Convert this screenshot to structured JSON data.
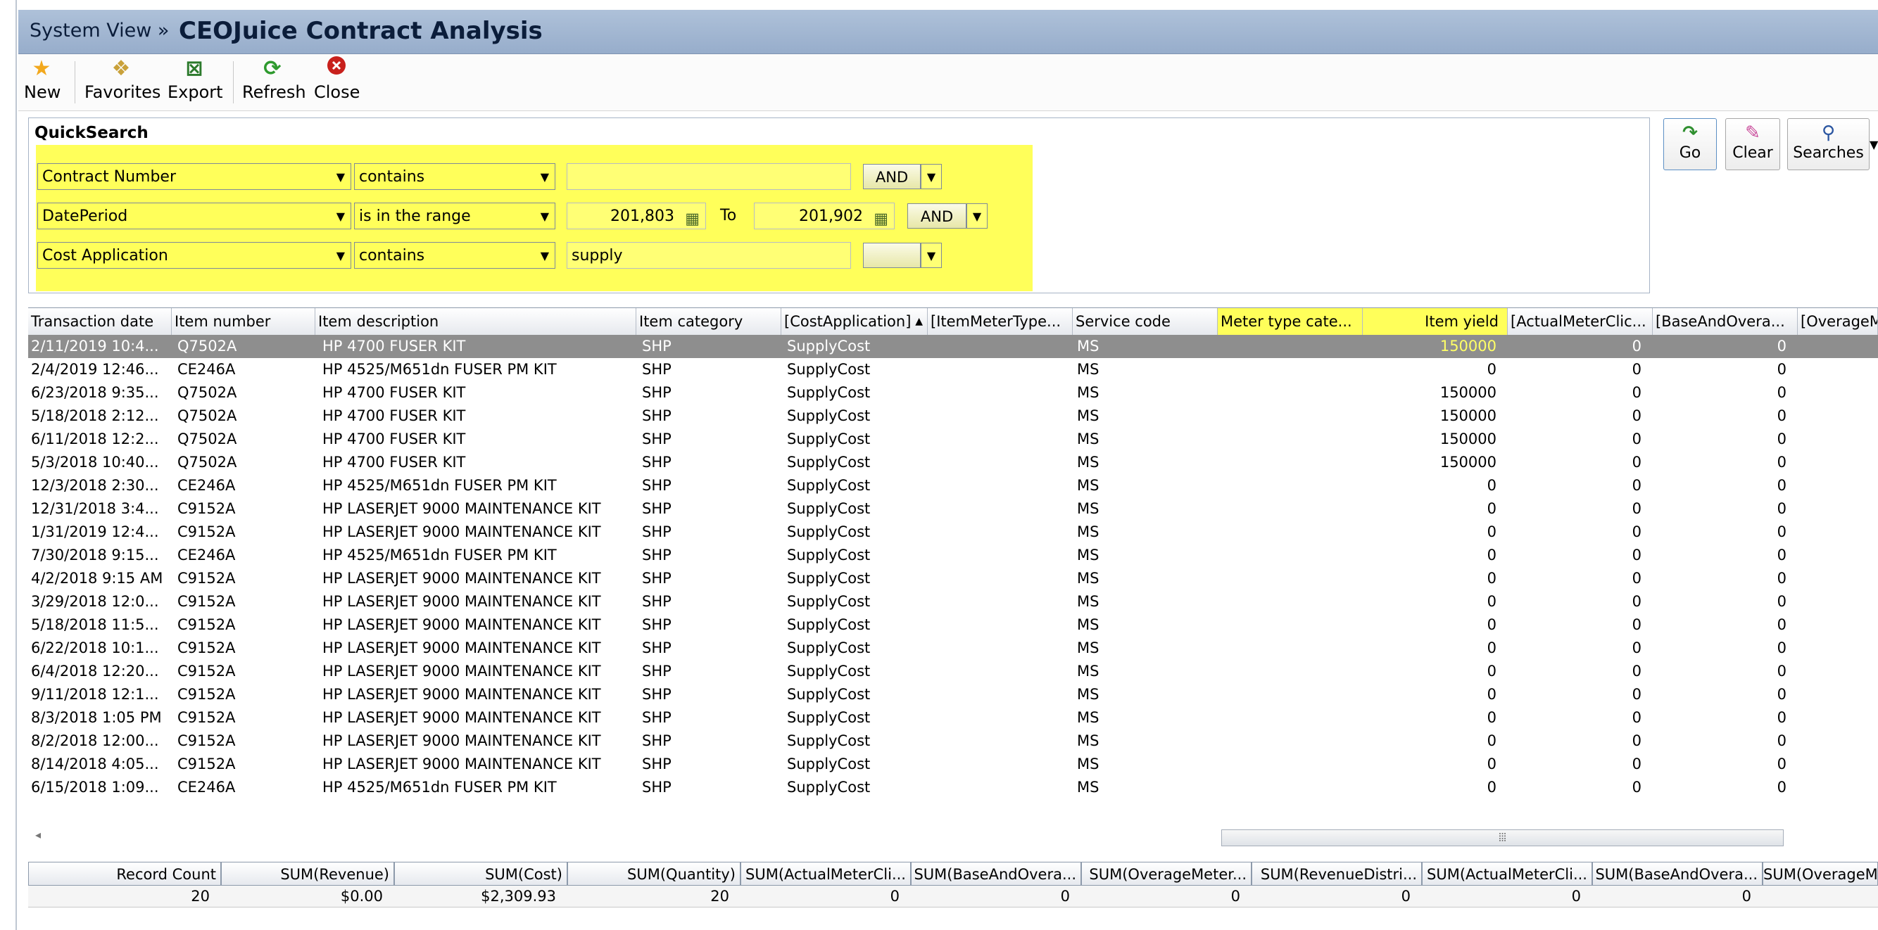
{
  "window": {
    "breadcrumb": "System View »",
    "title": "CEOJuice Contract Analysis"
  },
  "toolbar": {
    "new": "New",
    "favorites": "Favorites",
    "export": "Export",
    "refresh": "Refresh",
    "close": "Close"
  },
  "quicksearch": {
    "title": "QuickSearch",
    "rows": [
      {
        "field": "Contract Number",
        "operator": "contains",
        "value": "",
        "conj": "AND"
      },
      {
        "field": "DatePeriod",
        "operator": "is in the range",
        "from": "201,803",
        "to_label": "To",
        "to": "201,902",
        "conj": "AND"
      },
      {
        "field": "Cost Application",
        "operator": "contains",
        "value": "supply",
        "conj": ""
      }
    ],
    "buttons": {
      "go": "Go",
      "clear": "Clear",
      "searches": "Searches"
    }
  },
  "grid": {
    "columns": [
      "Transaction date",
      "Item number",
      "Item description",
      "Item category",
      "[CostApplication]",
      "[ItemMeterType...",
      "Service code",
      "Meter type cate...",
      "Item yield",
      "[ActualMeterClic...",
      "[BaseAndOvera...",
      "[OverageM"
    ],
    "rows": [
      [
        "2/11/2019 10:4...",
        "Q7502A",
        "HP 4700 FUSER KIT",
        "SHP",
        "SupplyCost",
        "MS",
        "150000",
        "0",
        "0"
      ],
      [
        "2/4/2019 12:46...",
        "CE246A",
        "HP 4525/M651dn FUSER PM KIT",
        "SHP",
        "SupplyCost",
        "MS",
        "0",
        "0",
        "0"
      ],
      [
        "6/23/2018 9:35...",
        "Q7502A",
        "HP 4700 FUSER KIT",
        "SHP",
        "SupplyCost",
        "MS",
        "150000",
        "0",
        "0"
      ],
      [
        "5/18/2018 2:12...",
        "Q7502A",
        "HP 4700 FUSER KIT",
        "SHP",
        "SupplyCost",
        "MS",
        "150000",
        "0",
        "0"
      ],
      [
        "6/11/2018 12:2...",
        "Q7502A",
        "HP 4700 FUSER KIT",
        "SHP",
        "SupplyCost",
        "MS",
        "150000",
        "0",
        "0"
      ],
      [
        "5/3/2018 10:40...",
        "Q7502A",
        "HP 4700 FUSER KIT",
        "SHP",
        "SupplyCost",
        "MS",
        "150000",
        "0",
        "0"
      ],
      [
        "12/3/2018 2:30...",
        "CE246A",
        "HP 4525/M651dn FUSER PM KIT",
        "SHP",
        "SupplyCost",
        "MS",
        "0",
        "0",
        "0"
      ],
      [
        "12/31/2018 3:4...",
        "C9152A",
        "HP LASERJET 9000 MAINTENANCE KIT",
        "SHP",
        "SupplyCost",
        "MS",
        "0",
        "0",
        "0"
      ],
      [
        "1/31/2019 12:4...",
        "C9152A",
        "HP LASERJET 9000 MAINTENANCE KIT",
        "SHP",
        "SupplyCost",
        "MS",
        "0",
        "0",
        "0"
      ],
      [
        "7/30/2018 9:15...",
        "CE246A",
        "HP 4525/M651dn FUSER PM KIT",
        "SHP",
        "SupplyCost",
        "MS",
        "0",
        "0",
        "0"
      ],
      [
        "4/2/2018 9:15 AM",
        "C9152A",
        "HP LASERJET 9000 MAINTENANCE KIT",
        "SHP",
        "SupplyCost",
        "MS",
        "0",
        "0",
        "0"
      ],
      [
        "3/29/2018 12:0...",
        "C9152A",
        "HP LASERJET 9000 MAINTENANCE KIT",
        "SHP",
        "SupplyCost",
        "MS",
        "0",
        "0",
        "0"
      ],
      [
        "5/18/2018 11:5...",
        "C9152A",
        "HP LASERJET 9000 MAINTENANCE KIT",
        "SHP",
        "SupplyCost",
        "MS",
        "0",
        "0",
        "0"
      ],
      [
        "6/22/2018 10:1...",
        "C9152A",
        "HP LASERJET 9000 MAINTENANCE KIT",
        "SHP",
        "SupplyCost",
        "MS",
        "0",
        "0",
        "0"
      ],
      [
        "6/4/2018 12:20...",
        "C9152A",
        "HP LASERJET 9000 MAINTENANCE KIT",
        "SHP",
        "SupplyCost",
        "MS",
        "0",
        "0",
        "0"
      ],
      [
        "9/11/2018 12:1...",
        "C9152A",
        "HP LASERJET 9000 MAINTENANCE KIT",
        "SHP",
        "SupplyCost",
        "MS",
        "0",
        "0",
        "0"
      ],
      [
        "8/3/2018 1:05 PM",
        "C9152A",
        "HP LASERJET 9000 MAINTENANCE KIT",
        "SHP",
        "SupplyCost",
        "MS",
        "0",
        "0",
        "0"
      ],
      [
        "8/2/2018 12:00...",
        "C9152A",
        "HP LASERJET 9000 MAINTENANCE KIT",
        "SHP",
        "SupplyCost",
        "MS",
        "0",
        "0",
        "0"
      ],
      [
        "8/14/2018 4:05...",
        "C9152A",
        "HP LASERJET 9000 MAINTENANCE KIT",
        "SHP",
        "SupplyCost",
        "MS",
        "0",
        "0",
        "0"
      ],
      [
        "6/15/2018 1:09...",
        "CE246A",
        "HP 4525/M651dn FUSER PM KIT",
        "SHP",
        "SupplyCost",
        "MS",
        "0",
        "0",
        "0"
      ]
    ]
  },
  "summary": {
    "headers": [
      "Record Count",
      "SUM(Revenue)",
      "SUM(Cost)",
      "SUM(Quantity)",
      "SUM(ActualMeterCli...",
      "SUM(BaseAndOvera...",
      "SUM(OverageMeter...",
      "SUM(RevenueDistri...",
      "SUM(ActualMeterCli...",
      "SUM(BaseAndOvera...",
      "SUM(OverageMe"
    ],
    "values": [
      "20",
      "$0.00",
      "$2,309.93",
      "20",
      "0",
      "0",
      "0",
      "0",
      "0",
      "0",
      ""
    ]
  },
  "colors": {
    "highlight": "#ffff5a",
    "titlebar": "#a5b9d4",
    "selected_row": "#8e8e8e"
  }
}
